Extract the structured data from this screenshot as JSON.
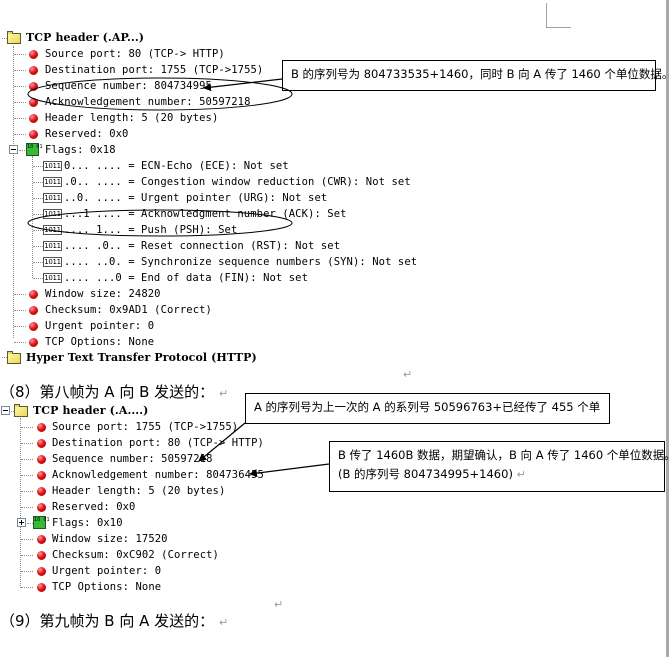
{
  "frame7_tree": {
    "tcp_header": "TCP header (.AP...)",
    "fields": [
      "Source port: 80 (TCP-> HTTP)",
      "Destination port: 1755 (TCP->1755)",
      "Sequence number: 804734995",
      "Acknowledgement number: 50597218",
      "Header length: 5 (20 bytes)",
      "Reserved: 0x0"
    ],
    "flags_label": "Flags: 0x18",
    "flag_bits": [
      "0... .... = ECN-Echo (ECE): Not set",
      ".0.. .... = Congestion window reduction (CWR): Not set",
      "..0. .... = Urgent pointer (URG): Not set",
      "...1 .... = Acknowledgment number (ACK): Set",
      ".... 1... = Push (PSH): Set",
      ".... .0.. = Reset connection (RST): Not set",
      ".... ..0. = Synchronize sequence numbers (SYN): Not set",
      ".... ...0 = End of data (FIN): Not set"
    ],
    "fields_after": [
      "Window size: 24820",
      "Checksum: 0x9AD1 (Correct)",
      "Urgent pointer: 0",
      "TCP Options: None"
    ],
    "http_label": "Hyper Text Transfer Protocol (HTTP)"
  },
  "bits_icon_label": "1011",
  "flags_icon_label": "10 01",
  "callouts": {
    "frame7_seq": "B 的序列号为 804733535+1460，同时 B 向 A 传了 1460 个单位数据。",
    "frame8_seq": "A 的序列号为上一次的 A 的系列号 50596763+已经传了 455 个单",
    "frame8_ack_line1": "B 传了 1460B 数据，期望确认，B 向 A 传了 1460 个单位数据。",
    "frame8_ack_line2": "(B 的序列号 804734995+1460)"
  },
  "headings": {
    "frame8": "（8）第八帧为 A 向 B 发送的：",
    "frame9": "（9）第九帧为 B 向 A 发送的："
  },
  "marks": {
    "paragraph": "↵"
  },
  "frame8_tree": {
    "tcp_header": "TCP header (.A....)",
    "fields": [
      "Source port: 1755 (TCP->1755)",
      "Destination port: 80 (TCP-> HTTP)",
      "Sequence number: 50597218",
      "Acknowledgement number: 804736455",
      "Header length: 5 (20 bytes)",
      "Reserved: 0x0"
    ],
    "flags_label": "Flags: 0x10",
    "fields_after": [
      "Window size: 17520",
      "Checksum: 0xC902 (Correct)",
      "Urgent pointer: 0",
      "TCP Options: None"
    ]
  }
}
